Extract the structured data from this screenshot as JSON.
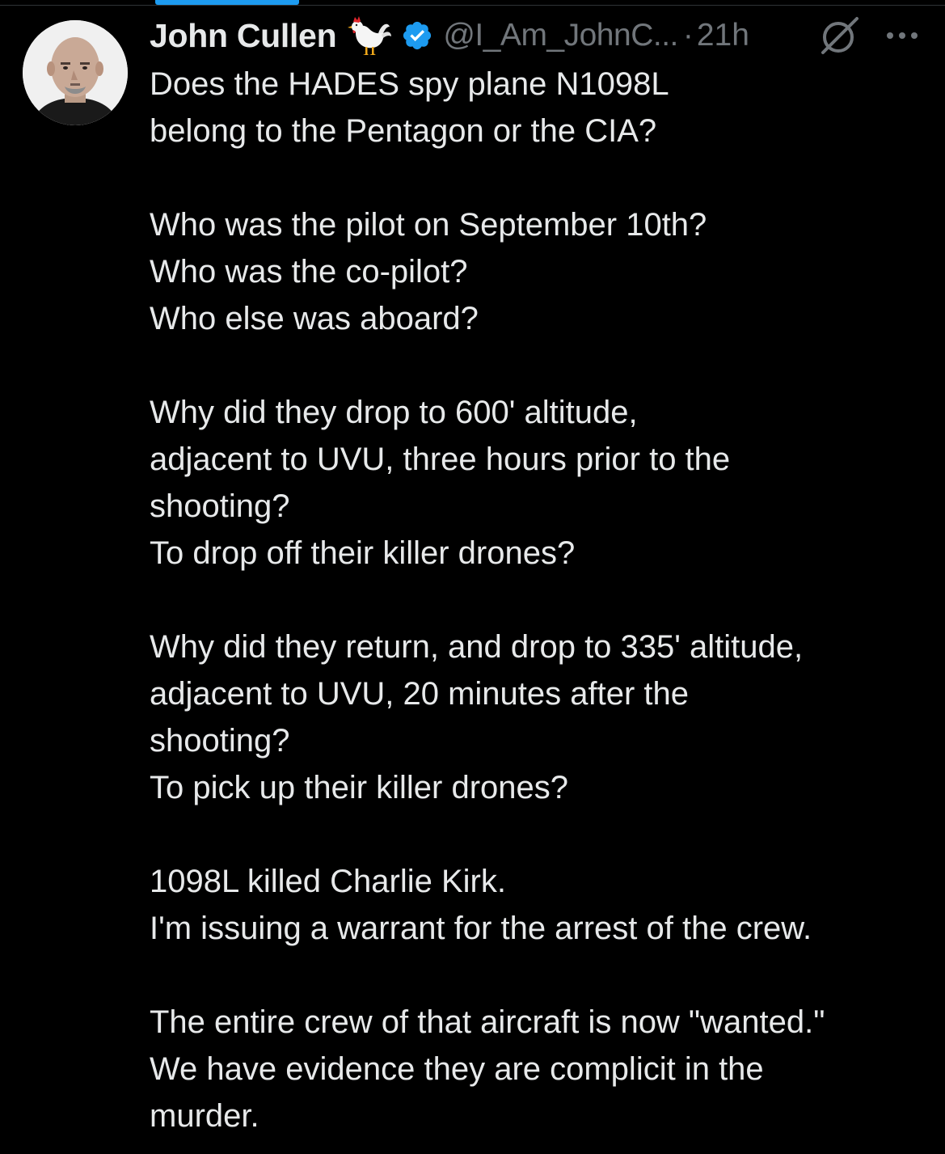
{
  "author": {
    "display_name": "John Cullen",
    "handle": "@I_Am_JohnC...",
    "separator": "·",
    "time": "21h",
    "emoji": "rooster-icon",
    "verified_color": "#1d9bf0"
  },
  "actions": {
    "grok_icon": "grok-icon",
    "more_icon": "more-icon"
  },
  "tweet": {
    "lines": [
      "Does the HADES spy plane N1098L",
      "belong to the Pentagon or the CIA?",
      "",
      "Who was the pilot on September 10th?",
      "Who was the co-pilot?",
      "Who else was aboard?",
      "",
      "Why did they drop to 600' altitude,",
      "adjacent to UVU, three hours prior to the",
      "shooting?",
      "To drop off their killer drones?",
      "",
      "Why did they return, and drop to 335' altitude,",
      "adjacent to UVU, 20 minutes after the",
      "shooting?",
      "To pick up their killer drones?",
      "",
      "1098L killed Charlie Kirk.",
      "I'm issuing a warrant for the arrest of the crew.",
      "",
      "The entire crew of that aircraft is now \"wanted.\"",
      "We have evidence they are complicit in the",
      "murder."
    ]
  },
  "colors": {
    "background": "#000000",
    "text": "#e7e9ea",
    "secondary": "#71767b",
    "accent": "#1d9bf0"
  }
}
